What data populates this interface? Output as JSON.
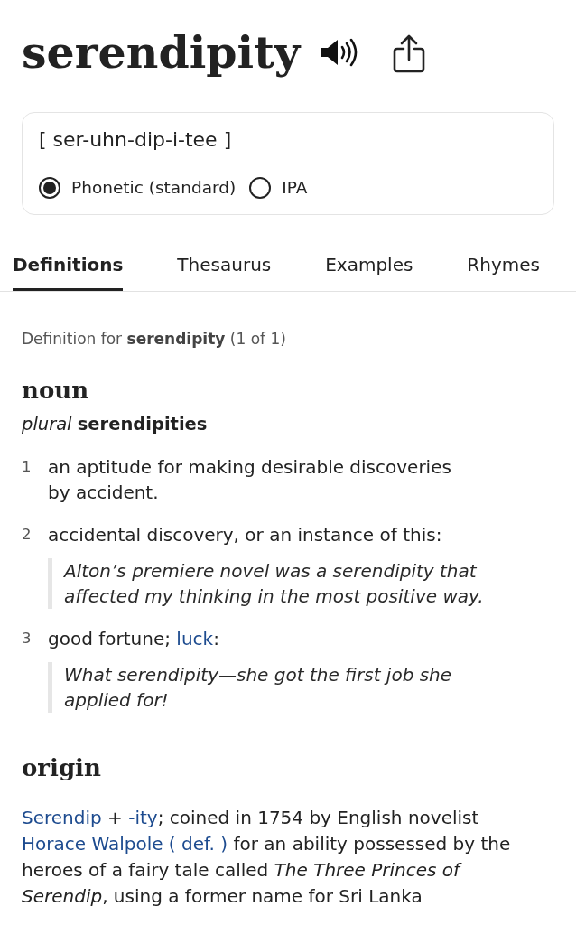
{
  "header": {
    "word": "serendipity"
  },
  "pronunciation": {
    "text": "[ ser-uhn-dip-i-tee ]",
    "options": [
      {
        "label": "Phonetic (standard)",
        "selected": true
      },
      {
        "label": "IPA",
        "selected": false
      }
    ]
  },
  "tabs": [
    {
      "label": "Definitions",
      "selected": true
    },
    {
      "label": "Thesaurus",
      "selected": false
    },
    {
      "label": "Examples",
      "selected": false
    },
    {
      "label": "Rhymes",
      "selected": false
    }
  ],
  "definitions": {
    "heading": "Definition for **serendipity** (1 of 1)",
    "part_of_speech": "noun",
    "plural": "*plural* **serendipities**",
    "senses": [
      {
        "number": "1",
        "segments": [
          {
            "kind": "text",
            "text": "an aptitude for making desirable discoveries by accident."
          }
        ]
      },
      {
        "number": "2",
        "segments": [
          {
            "kind": "text",
            "text": "accidental discovery, or an instance of this:"
          }
        ],
        "example": "Alton’s premiere novel was a serendipity that affected my thinking in the most positive way."
      },
      {
        "number": "3",
        "segments": [
          {
            "kind": "text",
            "text": "good fortune; "
          },
          {
            "kind": "link",
            "text": "luck"
          },
          {
            "kind": "text",
            "text": ":"
          }
        ],
        "example": "What serendipity—she got the first job she applied for!"
      }
    ]
  },
  "origin": {
    "heading": "origin",
    "segments": [
      {
        "kind": "link",
        "text": "Serendip"
      },
      {
        "kind": "text",
        "text": " + "
      },
      {
        "kind": "link",
        "text": "-ity"
      },
      {
        "kind": "text",
        "text": "; coined in 1754 by English novelist "
      },
      {
        "kind": "link",
        "text": "Horace Walpole ( def. )"
      },
      {
        "kind": "text",
        "text": " for an ability possessed by the heroes of a fairy tale called *The Three Princes of Serendip*, using a former name for Sri Lanka"
      }
    ]
  }
}
